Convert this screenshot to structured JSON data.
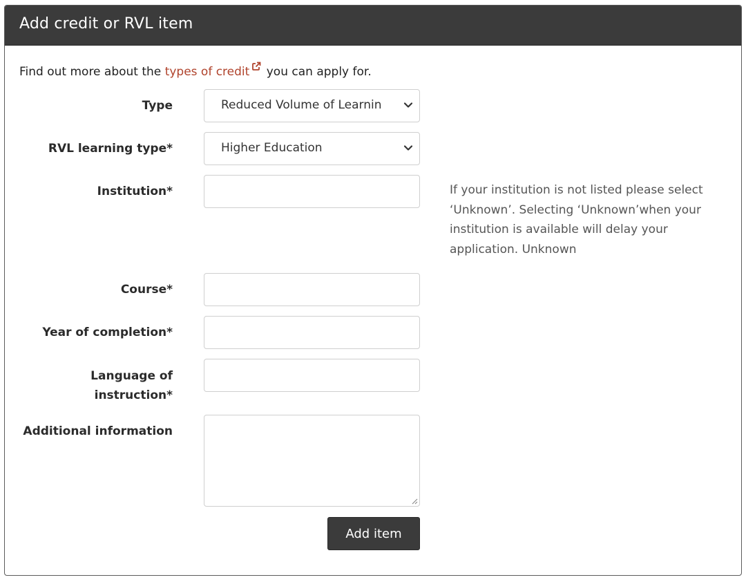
{
  "panel": {
    "title": "Add credit or RVL item"
  },
  "intro": {
    "prefix": "Find out more about the ",
    "link_text": "types of credit",
    "suffix": " you can apply for.",
    "link_icon": "external-link-icon"
  },
  "form": {
    "type": {
      "label": "Type",
      "value": "Reduced Volume of Learnin"
    },
    "rvl_learning_type": {
      "label": "RVL learning type*",
      "value": "Higher Education"
    },
    "institution": {
      "label": "Institution*",
      "value": "",
      "help": "If your institution is not listed please select ‘Unknown’. Selecting ‘Unknown’when your institution is available will delay your application. Unknown"
    },
    "course": {
      "label": "Course*",
      "value": ""
    },
    "year_of_completion": {
      "label": "Year of completion*",
      "value": ""
    },
    "language_of_instruction": {
      "label_line1": "Language of",
      "label_line2": "instruction*",
      "value": ""
    },
    "additional_information": {
      "label": "Additional information",
      "value": ""
    },
    "submit_label": "Add item"
  },
  "colors": {
    "header_bg": "#3b3b3b",
    "link": "#b0432c",
    "button_bg": "#3b3b3b",
    "border": "#cfcfcf"
  }
}
